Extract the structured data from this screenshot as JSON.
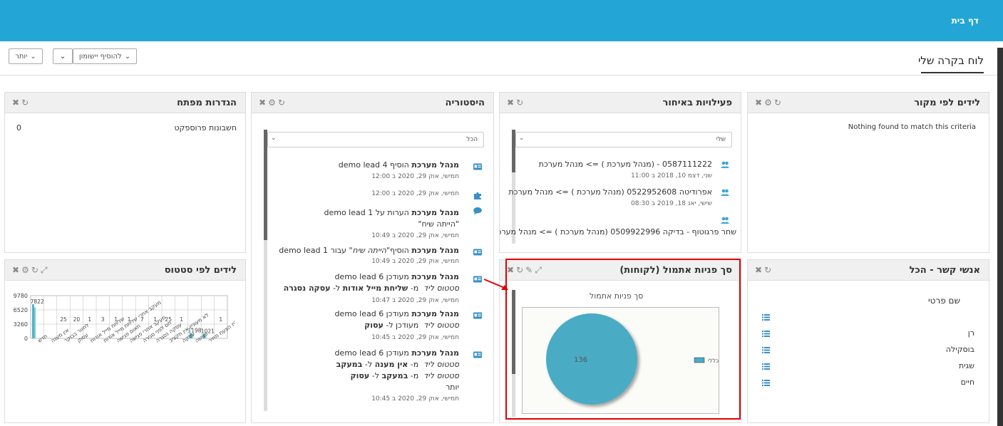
{
  "header": {
    "home": "דף בית"
  },
  "toolbar": {
    "title": "לוח בקרה שלי",
    "add_dashlet": "להוסיף יישומון",
    "more": "יותר"
  },
  "panels": {
    "leads_by_source": {
      "title": "לידים לפי מקור",
      "empty": "Nothing found to match this criteria"
    },
    "late_activities": {
      "title": "פעילויות באיחור",
      "filter": "שלי",
      "items": [
        {
          "text": "0587111222 - (מנהל מערכת ) => מנהל מערכת",
          "date": "שני, דצמ 10, 2018 ב 11:00"
        },
        {
          "text": "אפרודיטה 0522952608 (מנהל מערכת ) => מנהל מערכת",
          "date": "שישי, יאנ 18, 2019 ב 08:30"
        },
        {
          "text": "שחר פרגוטוף - בדיקה 0509922996 (מנהל מערכת ) => מנהל מערכת",
          "date": ""
        }
      ]
    },
    "history": {
      "title": "היסטוריה",
      "filter": "הכל",
      "entries": [
        {
          "user": "מנהל מערכת",
          "line": "הוסיף demo lead 4",
          "date": "חמישי, אוק 29, 2020 ב 12:00"
        },
        {
          "date": "חמישי, אוק 29, 2020 ב 12:00"
        },
        {
          "user": "מנהל מערכת",
          "line": "הערות על demo lead 1",
          "quote": "\"הייתה שיח\"",
          "date": "חמישי, אוק 29, 2020 ב 10:49"
        },
        {
          "user": "מנהל מערכת",
          "line": "הוסיף",
          "quote": "\"הייתה שיח\"",
          "tail": "עבור demo lead 1",
          "date": "חמישי, אוק 29, 2020 ב 10:49"
        },
        {
          "user": "מנהל מערכת",
          "line": "מעודכן demo lead 6",
          "status_label": "סטטוס ליד",
          "from": "שליחת מייל אודות",
          "to": "עסקה נסגרה",
          "date": "חמישי, אוק 29, 2020 ב 10:47"
        },
        {
          "user": "מנהל מערכת",
          "line": "מעודכן demo lead 6",
          "status_label": "סטטוס ליד",
          "to": "עסוק",
          "date": "חמישי, אוק 29, 2020 ב 10:45"
        },
        {
          "user": "מנהל מערכת",
          "line": "מעודכן demo lead 6",
          "status_label": "סטטוס ליד",
          "from": "אין מענה",
          "to": "במעקב",
          "status_label2": "סטטוס ליד",
          "from2": "במעקב",
          "to2": "עסוק",
          "more": "יותר",
          "date": "חמישי, אוק 29, 2020 ב 10:45"
        }
      ],
      "words": {
        "from": "מ-",
        "to": "ל-",
        "updated_to": "מעודכן ל-"
      }
    },
    "key_settings": {
      "title": "הגדרות מפתח",
      "row_label": "חשבונות פרוספקט",
      "row_value": "0"
    },
    "contacts": {
      "title": "אנשי קשר - הכל",
      "column": "שם פרטי",
      "names": [
        "",
        "רן",
        "בוסקילה",
        "שגית",
        "חיים"
      ]
    },
    "potential_sum": {
      "title": "סך פניות אתמול (לקוחות)",
      "chart_title": "סך פניות אתמול",
      "legend": "כללי",
      "value": "136"
    },
    "leads_by_status": {
      "title": "לידים לפי סטטוס"
    }
  },
  "chart_data": [
    {
      "type": "bar",
      "title": "",
      "ylim": [
        0,
        9780
      ],
      "yticks": [
        "9780",
        "6520",
        "3260",
        "0"
      ],
      "categories": [
        "חדש",
        "אין מענה",
        "לחזור בבוקר",
        "עסוק",
        "שליחת מייל אודות",
        "מעקב אחרי שליחת מייל אודות",
        "תאום פגישה",
        "מעקב אחרי פגישה",
        "חם לפני סגירה",
        "עסקה נסגרה",
        "לא מעוניין אין תקציב",
        "עסקה",
        "פגישה",
        "נשלח הצעת מחיר"
      ],
      "values": [
        7822,
        0,
        25,
        20,
        1,
        3,
        1,
        1,
        7,
        1,
        25,
        1,
        1198,
        1021
      ],
      "labels": [
        "7822",
        "",
        "25",
        "20",
        "1",
        "3",
        "1",
        "1",
        "7",
        "1",
        "25",
        "1",
        "1198",
        "1021",
        "1"
      ]
    },
    {
      "type": "pie",
      "title": "סך פניות אתמול",
      "categories": [
        "כללי"
      ],
      "values": [
        136
      ]
    }
  ],
  "colors": {
    "accent": "#23a6d5",
    "bar": "#4fb3c8",
    "pie": "#4aabc4",
    "highlight": "#e00000"
  }
}
